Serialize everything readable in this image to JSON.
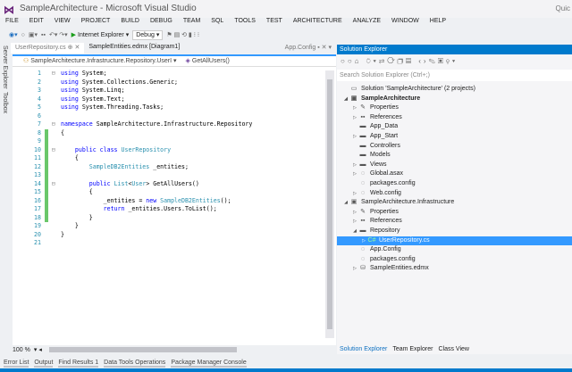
{
  "window": {
    "title": "SampleArchitecture - Microsoft Visual Studio",
    "quick_launch": "Quic"
  },
  "menu": [
    "FILE",
    "EDIT",
    "VIEW",
    "PROJECT",
    "BUILD",
    "DEBUG",
    "TEAM",
    "SQL",
    "TOOLS",
    "TEST",
    "ARCHITECTURE",
    "ANALYZE",
    "WINDOW",
    "HELP"
  ],
  "toolbar": {
    "browser": "Internet Explorer",
    "config": "Debug"
  },
  "side_strip": [
    "Server Explorer",
    "Toolbox"
  ],
  "tabs": [
    {
      "label": "UserRepository.cs",
      "active": true
    },
    {
      "label": "SampleEntities.edmx [Diagram1]"
    },
    {
      "label": "App.Config"
    }
  ],
  "nav": {
    "type": "SampleArchitecture.Infrastructure.Repository.UserI",
    "member": "GetAllUsers()"
  },
  "code": [
    [
      [
        "using",
        "k"
      ],
      [
        " System;",
        "p"
      ]
    ],
    [
      [
        "using",
        "k"
      ],
      [
        " System.Collections.Generic;",
        "p"
      ]
    ],
    [
      [
        "using",
        "k"
      ],
      [
        " System.Linq;",
        "p"
      ]
    ],
    [
      [
        "using",
        "k"
      ],
      [
        " System.Text;",
        "p"
      ]
    ],
    [
      [
        "using",
        "k"
      ],
      [
        " System.Threading.Tasks;",
        "p"
      ]
    ],
    [],
    [
      [
        "namespace",
        "k"
      ],
      [
        " SampleArchitecture.Infrastructure.Repository",
        "p"
      ]
    ],
    [
      [
        "{",
        "p"
      ]
    ],
    [],
    [
      [
        "    public class ",
        "k"
      ],
      [
        "UserRepository",
        "ty"
      ]
    ],
    [
      [
        "    {",
        "p"
      ]
    ],
    [
      [
        "        ",
        "p"
      ],
      [
        "SampleDB2Entities",
        "ty"
      ],
      [
        " _entities;",
        "p"
      ]
    ],
    [],
    [
      [
        "        public ",
        "k"
      ],
      [
        "List",
        "ty"
      ],
      [
        "<",
        "p"
      ],
      [
        "User",
        "ty"
      ],
      [
        "> GetAllUsers()",
        "p"
      ]
    ],
    [
      [
        "        {",
        "p"
      ]
    ],
    [
      [
        "            _entities = ",
        "p"
      ],
      [
        "new ",
        "k"
      ],
      [
        "SampleDB2Entities",
        "ty"
      ],
      [
        "();",
        "p"
      ]
    ],
    [
      [
        "            return",
        "k"
      ],
      [
        " _entities.Users.ToList();",
        "p"
      ]
    ],
    [
      [
        "        }",
        "p"
      ]
    ],
    [
      [
        "    }",
        "p"
      ]
    ],
    [
      [
        "}",
        "p"
      ]
    ],
    []
  ],
  "changed_lines": [
    8,
    9,
    10,
    11,
    12,
    13,
    14,
    15,
    16,
    17,
    18
  ],
  "zoom": "100 %",
  "solution_explorer": {
    "title": "Solution Explorer",
    "search_placeholder": "Search Solution Explorer (Ctrl+;)",
    "tree": [
      {
        "label": "Solution 'SampleArchitecture' (2 projects)",
        "level": 0,
        "icon": "solution-icon",
        "arrow": ""
      },
      {
        "label": "SampleArchitecture",
        "level": 0,
        "icon": "web-project-icon",
        "arrow": "expanded",
        "bold": true
      },
      {
        "label": "Properties",
        "level": 1,
        "icon": "wrench-icon",
        "arrow": "collapsed"
      },
      {
        "label": "References",
        "level": 1,
        "icon": "references-icon",
        "arrow": "collapsed"
      },
      {
        "label": "App_Data",
        "level": 1,
        "icon": "folder-icon",
        "arrow": ""
      },
      {
        "label": "App_Start",
        "level": 1,
        "icon": "folder-icon",
        "arrow": "collapsed"
      },
      {
        "label": "Controllers",
        "level": 1,
        "icon": "folder-icon",
        "arrow": ""
      },
      {
        "label": "Models",
        "level": 1,
        "icon": "folder-icon",
        "arrow": ""
      },
      {
        "label": "Views",
        "level": 1,
        "icon": "folder-icon",
        "arrow": "collapsed"
      },
      {
        "label": "Global.asax",
        "level": 1,
        "icon": "config-file-icon",
        "arrow": "collapsed"
      },
      {
        "label": "packages.config",
        "level": 1,
        "icon": "config-file-icon",
        "arrow": ""
      },
      {
        "label": "Web.config",
        "level": 1,
        "icon": "config-file-icon",
        "arrow": "collapsed"
      },
      {
        "label": "SampleArchitecture.Infrastructure",
        "level": 0,
        "icon": "csharp-project-icon",
        "arrow": "expanded"
      },
      {
        "label": "Properties",
        "level": 1,
        "icon": "wrench-icon",
        "arrow": "collapsed"
      },
      {
        "label": "References",
        "level": 1,
        "icon": "references-icon",
        "arrow": "collapsed"
      },
      {
        "label": "Repository",
        "level": 1,
        "icon": "folder-open-icon",
        "arrow": "expanded"
      },
      {
        "label": "UserRepository.cs",
        "level": 2,
        "icon": "csharp-file-icon",
        "arrow": "collapsed",
        "selected": true
      },
      {
        "label": "App.Config",
        "level": 1,
        "icon": "config-file-icon",
        "arrow": ""
      },
      {
        "label": "packages.config",
        "level": 1,
        "icon": "config-file-icon",
        "arrow": ""
      },
      {
        "label": "SampleEntities.edmx",
        "level": 1,
        "icon": "edmx-icon",
        "arrow": "collapsed"
      }
    ],
    "tabs": [
      "Solution Explorer",
      "Team Explorer",
      "Class View"
    ]
  },
  "bottom_tabs": [
    "Error List",
    "Output",
    "Find Results 1",
    "Data Tools Operations",
    "Package Manager Console"
  ],
  "colors": {
    "accent": "#007acc",
    "selection": "#3399ff",
    "keyword": "#0000ff",
    "type": "#2b91af",
    "changed": "#6ac76a"
  }
}
